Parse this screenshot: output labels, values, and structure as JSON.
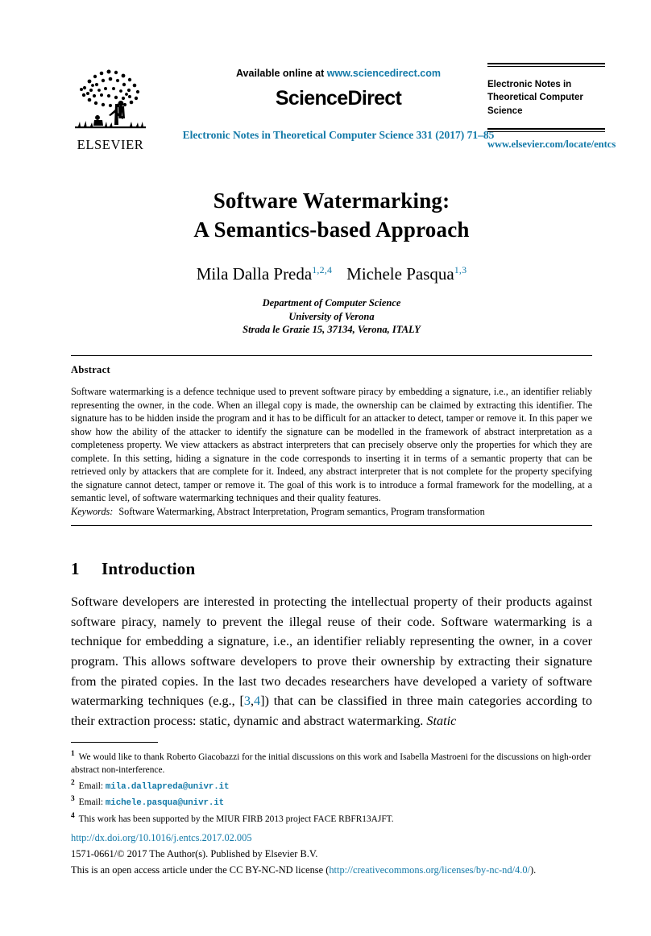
{
  "header": {
    "available_online": "Available online at ",
    "sciencedirect_url": "www.sciencedirect.com",
    "sciencedirect_wordmark": "ScienceDirect",
    "journal_citation": "Electronic Notes in Theoretical Computer Science 331 (2017) 71–85",
    "journal_name": "Electronic Notes in Theoretical Computer Science",
    "publisher_url": "www.elsevier.com/locate/entcs",
    "publisher_logo_text": "ELSEVIER"
  },
  "title": {
    "line1": "Software Watermarking:",
    "line2": "A Semantics-based Approach"
  },
  "authors": [
    {
      "name": "Mila Dalla Preda",
      "footnotes": "1,2,4"
    },
    {
      "name": "Michele Pasqua",
      "footnotes": "1,3"
    }
  ],
  "affiliation": {
    "line1": "Department of Computer Science",
    "line2": "University of Verona",
    "line3": "Strada le Grazie 15, 37134, Verona, ITALY"
  },
  "abstract": {
    "heading": "Abstract",
    "body": "Software watermarking is a defence technique used to prevent software piracy by embedding a signature, i.e., an identifier reliably representing the owner, in the code. When an illegal copy is made, the ownership can be claimed by extracting this identifier. The signature has to be hidden inside the program and it has to be difficult for an attacker to detect, tamper or remove it. In this paper we show how the ability of the attacker to identify the signature can be modelled in the framework of abstract interpretation as a completeness property. We view attackers as abstract interpreters that can precisely observe only the properties for which they are complete. In this setting, hiding a signature in the code corresponds to inserting it in terms of a semantic property that can be retrieved only by attackers that are complete for it. Indeed, any abstract interpreter that is not complete for the property specifying the signature cannot detect, tamper or remove it. The goal of this work is to introduce a formal framework for the modelling, at a semantic level, of software watermarking techniques and their quality features."
  },
  "keywords": {
    "label": "Keywords:",
    "value": "Software Watermarking, Abstract Interpretation, Program semantics, Program transformation"
  },
  "section": {
    "number": "1",
    "title": "Introduction",
    "paragraph_part1": "Software developers are interested in protecting the intellectual property of their products against software piracy, namely to prevent the illegal reuse of their code. Software watermarking is a technique for embedding a signature, i.e., an identifier reliably representing the owner, in a cover program. This allows software developers to prove their ownership by extracting their signature from the pirated copies. In the last two decades researchers have developed a variety of software watermarking techniques (e.g., [",
    "citation_a": "3",
    "citation_sep": ",",
    "citation_b": "4",
    "paragraph_part2": "]) that can be classified in three main categories according to their extraction process: static, dynamic and abstract watermarking. ",
    "paragraph_italic_tail": "Static"
  },
  "footnotes": [
    {
      "marker": "1",
      "text": "We would like to thank Roberto Giacobazzi for the initial discussions on this work and Isabella Mastroeni for the discussions on high-order abstract non-interference."
    },
    {
      "marker": "2",
      "label": "Email:",
      "email": "mila.dallapreda@univr.it"
    },
    {
      "marker": "3",
      "label": "Email:",
      "email": "michele.pasqua@univr.it"
    },
    {
      "marker": "4",
      "text": "This work has been supported by the MIUR FIRB 2013 project FACE RBFR13AJFT."
    }
  ],
  "copyright": {
    "doi": "http://dx.doi.org/10.1016/j.entcs.2017.02.005",
    "issn_line": "1571-0661/© 2017 The Author(s). Published by Elsevier B.V.",
    "license_pre": "This is an open access article under the CC BY-NC-ND license (",
    "license_url": "http://creativecommons.org/licenses/by-nc-nd/4.0/",
    "license_post": ")."
  },
  "colors": {
    "link": "#1279a8",
    "text": "#000000",
    "background": "#ffffff"
  }
}
